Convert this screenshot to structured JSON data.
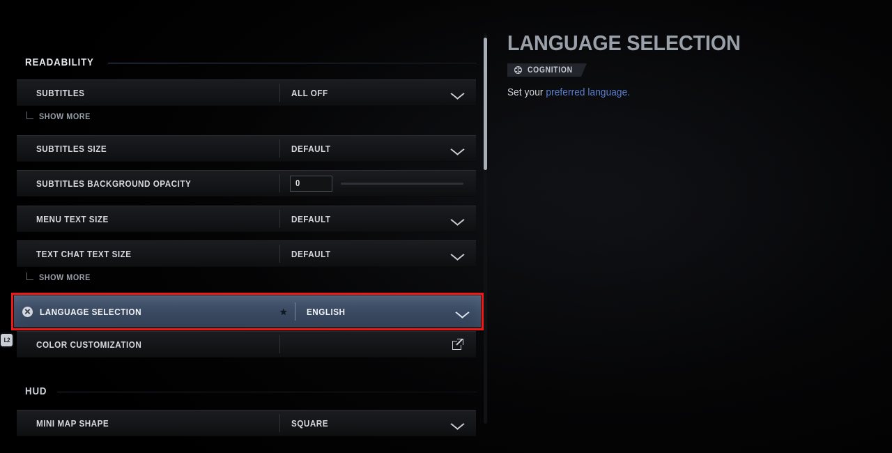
{
  "sections": [
    {
      "id": "readability",
      "label": "READABILITY",
      "style": "accent"
    },
    {
      "id": "hud",
      "label": "HUD",
      "style": "dim"
    }
  ],
  "rows": {
    "subtitles": {
      "label": "SUBTITLES",
      "value": "ALL OFF",
      "control": "dropdown"
    },
    "subtitles_size": {
      "label": "SUBTITLES SIZE",
      "value": "DEFAULT",
      "control": "dropdown"
    },
    "subtitles_opacity": {
      "label": "SUBTITLES BACKGROUND OPACITY",
      "value": "0",
      "control": "slider"
    },
    "menu_text_size": {
      "label": "MENU TEXT SIZE",
      "value": "DEFAULT",
      "control": "dropdown"
    },
    "text_chat_size": {
      "label": "TEXT CHAT TEXT SIZE",
      "value": "DEFAULT",
      "control": "dropdown"
    },
    "language": {
      "label": "LANGUAGE SELECTION",
      "value": "ENGLISH",
      "control": "dropdown",
      "selected": true,
      "favorite_glyph": "★"
    },
    "color_custom": {
      "label": "COLOR CUSTOMIZATION",
      "value": "",
      "control": "link"
    },
    "minimap_shape": {
      "label": "MINI MAP SHAPE",
      "value": "SQUARE",
      "control": "dropdown"
    }
  },
  "show_more": {
    "label": "SHOW MORE"
  },
  "controller_hint": {
    "label": "L2"
  },
  "info": {
    "title": "LANGUAGE SELECTION",
    "badge": "COGNITION",
    "desc_plain": "Set your ",
    "desc_highlight": "preferred language."
  },
  "colors": {
    "accent_blue": "#5c7fd1",
    "annotation_red": "#f01919",
    "selected_row": "#3e4e66",
    "panel_bg": "#151619"
  }
}
